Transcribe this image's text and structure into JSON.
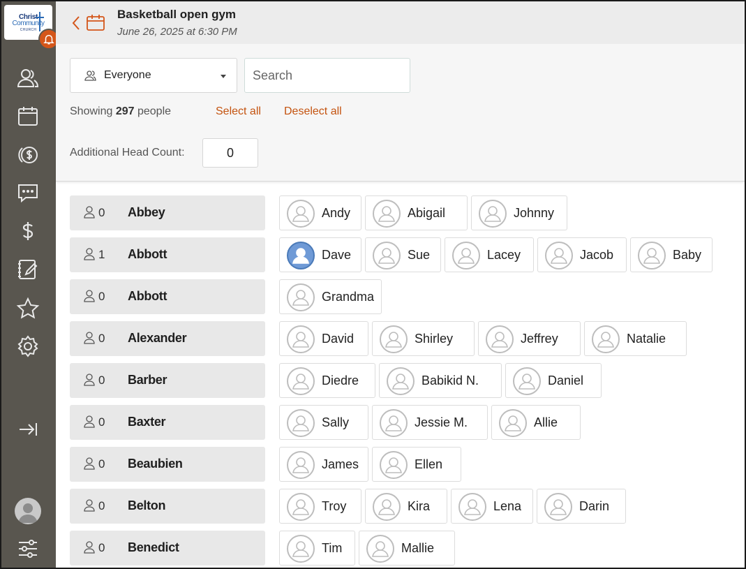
{
  "logo": {
    "line1": "Christ",
    "line2": "Community",
    "line3": "CHURCH"
  },
  "header": {
    "title": "Basketball open gym",
    "subtitle": "June 26, 2025 at 6:30 PM"
  },
  "filter": {
    "group_selected": "Everyone",
    "search_placeholder": "Search",
    "showing_prefix": "Showing",
    "showing_count": "297",
    "showing_suffix": "people",
    "select_all": "Select all",
    "deselect_all": "Deselect all",
    "head_count_label": "Additional Head Count:",
    "head_count_value": "0"
  },
  "sidebar": {
    "icons": [
      "people-icon",
      "calendar-icon",
      "giving-icon",
      "messages-icon",
      "dollar-icon",
      "notes-icon",
      "star-icon",
      "settings-icon",
      "collapse-icon",
      "avatar",
      "filters-icon"
    ]
  },
  "colors": {
    "accent": "#c4530f",
    "sidebar": "#59564f",
    "selected_avatar": "#6f9ad6"
  },
  "households": [
    {
      "name": "Abbey",
      "count": "0",
      "members": [
        {
          "name": "Andy"
        },
        {
          "name": "Abigail"
        },
        {
          "name": "Johnny"
        }
      ]
    },
    {
      "name": "Abbott",
      "count": "1",
      "members": [
        {
          "name": "Dave",
          "selected": true
        },
        {
          "name": "Sue"
        },
        {
          "name": "Lacey"
        },
        {
          "name": "Jacob"
        },
        {
          "name": "Baby"
        }
      ]
    },
    {
      "name": "Abbott",
      "count": "0",
      "members": [
        {
          "name": "Grandma"
        }
      ]
    },
    {
      "name": "Alexander",
      "count": "0",
      "members": [
        {
          "name": "David"
        },
        {
          "name": "Shirley"
        },
        {
          "name": "Jeffrey"
        },
        {
          "name": "Natalie"
        }
      ]
    },
    {
      "name": "Barber",
      "count": "0",
      "members": [
        {
          "name": "Diedre"
        },
        {
          "name": "Babikid N."
        },
        {
          "name": "Daniel"
        }
      ]
    },
    {
      "name": "Baxter",
      "count": "0",
      "members": [
        {
          "name": "Sally"
        },
        {
          "name": "Jessie M."
        },
        {
          "name": "Allie"
        }
      ]
    },
    {
      "name": "Beaubien",
      "count": "0",
      "members": [
        {
          "name": "James"
        },
        {
          "name": "Ellen"
        }
      ]
    },
    {
      "name": "Belton",
      "count": "0",
      "members": [
        {
          "name": "Troy"
        },
        {
          "name": "Kira"
        },
        {
          "name": "Lena"
        },
        {
          "name": "Darin"
        }
      ]
    },
    {
      "name": "Benedict",
      "count": "0",
      "members": [
        {
          "name": "Tim"
        },
        {
          "name": "Mallie"
        }
      ]
    }
  ]
}
